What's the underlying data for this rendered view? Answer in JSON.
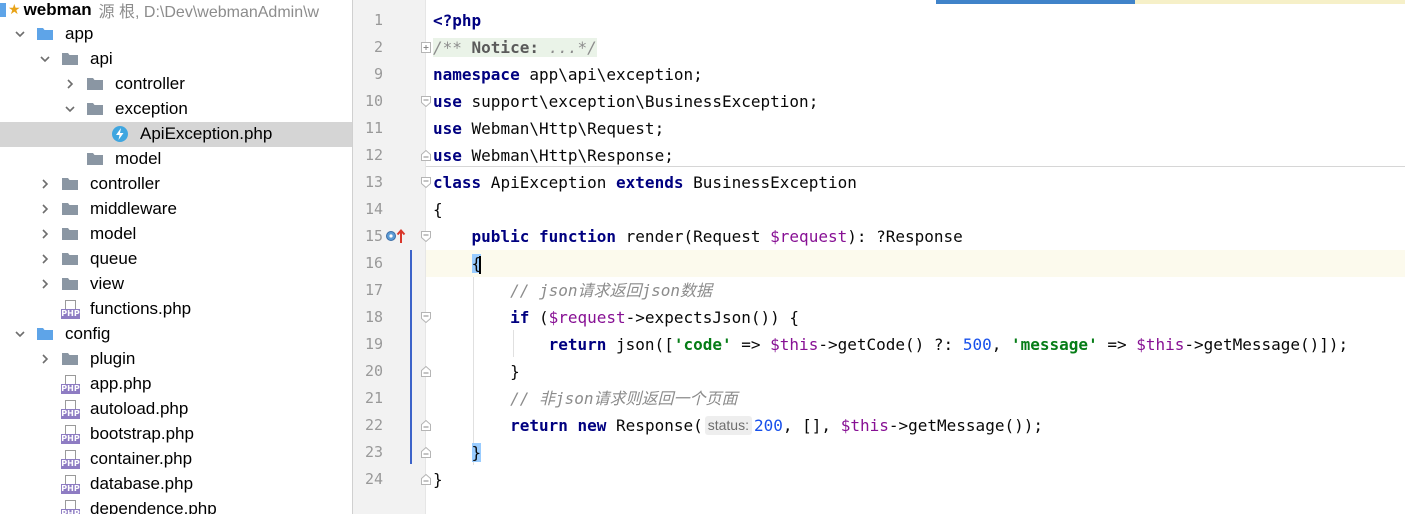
{
  "project": {
    "root_name": "webman",
    "root_path": "源 根, D:\\Dev\\webmanAdmin\\w"
  },
  "tree": [
    {
      "label": "app",
      "type": "folder",
      "depth": 0,
      "expanded": true
    },
    {
      "label": "api",
      "type": "folder",
      "depth": 1,
      "expanded": true
    },
    {
      "label": "controller",
      "type": "folder",
      "depth": 2,
      "expanded": false
    },
    {
      "label": "exception",
      "type": "folder",
      "depth": 2,
      "expanded": true
    },
    {
      "label": "ApiException.php",
      "type": "php-class",
      "depth": 3,
      "selected": true
    },
    {
      "label": "model",
      "type": "folder",
      "depth": 2,
      "leaf": true
    },
    {
      "label": "controller",
      "type": "folder",
      "depth": 1,
      "expanded": false
    },
    {
      "label": "middleware",
      "type": "folder",
      "depth": 1,
      "expanded": false
    },
    {
      "label": "model",
      "type": "folder",
      "depth": 1,
      "expanded": false
    },
    {
      "label": "queue",
      "type": "folder",
      "depth": 1,
      "expanded": false
    },
    {
      "label": "view",
      "type": "folder",
      "depth": 1,
      "expanded": false
    },
    {
      "label": "functions.php",
      "type": "php-file",
      "depth": 1
    },
    {
      "label": "config",
      "type": "folder",
      "depth": 0,
      "expanded": true
    },
    {
      "label": "plugin",
      "type": "folder",
      "depth": 1,
      "expanded": false
    },
    {
      "label": "app.php",
      "type": "php-file",
      "depth": 1
    },
    {
      "label": "autoload.php",
      "type": "php-file",
      "depth": 1
    },
    {
      "label": "bootstrap.php",
      "type": "php-file",
      "depth": 1
    },
    {
      "label": "container.php",
      "type": "php-file",
      "depth": 1
    },
    {
      "label": "database.php",
      "type": "php-file",
      "depth": 1
    },
    {
      "label": "dependence.php",
      "type": "php-file",
      "depth": 1
    }
  ],
  "icons": {
    "folder_color": "#8a96a3",
    "source_folder_color": "#5ea4e8",
    "php_badge_color": "#8e7cc3",
    "class_icon_color": "#3fa6e0"
  },
  "editor": {
    "line_numbers": [
      "1",
      "2",
      "9",
      "10",
      "11",
      "12",
      "13",
      "14",
      "15",
      "16",
      "17",
      "18",
      "19",
      "20",
      "21",
      "22",
      "23",
      "24"
    ],
    "current_line": "16",
    "code": {
      "php_open": "<?php",
      "notice_open": "/** ",
      "notice_label": "Notice:",
      "notice_rest": " ...*/",
      "l9_kw": "namespace",
      "l9_rest": " app\\api\\exception;",
      "use_kw": "use",
      "l10_rest": " support\\exception\\BusinessException;",
      "l11_rest": " Webman\\Http\\Request;",
      "l12_rest": " Webman\\Http\\Response;",
      "class_kw": "class",
      "class_name": " ApiException ",
      "extends_kw": "extends",
      "parent_class": " BusinessException",
      "open_brace": "{",
      "indent1": "    ",
      "indent2": "        ",
      "indent3": "            ",
      "public_kw": "public",
      "function_kw": "function",
      "render_sig_a": " render(Request ",
      "request_var": "$request",
      "render_sig_b": "): ?Response",
      "comment1": "// json请求返回json数据",
      "if_kw": "if",
      "if_a": " (",
      "if_b": "->expectsJson()) {",
      "return_kw": "return",
      "json_a": " json([",
      "code_str": "'code'",
      "arrow_op": " => ",
      "this_var": "$this",
      "getcode_a": "->getCode() ?: ",
      "num500": "500",
      "comma": ", ",
      "message_str": "'message'",
      "getmessage_a": "->getMessage()]);",
      "close_brace": "}",
      "comment2": "// 非json请求则返回一个页面",
      "new_kw": "new",
      "response_a": " Response(",
      "status_hint": "status:",
      "num200": "200",
      "response_b": ", [], ",
      "response_c": "->getMessage());"
    }
  }
}
